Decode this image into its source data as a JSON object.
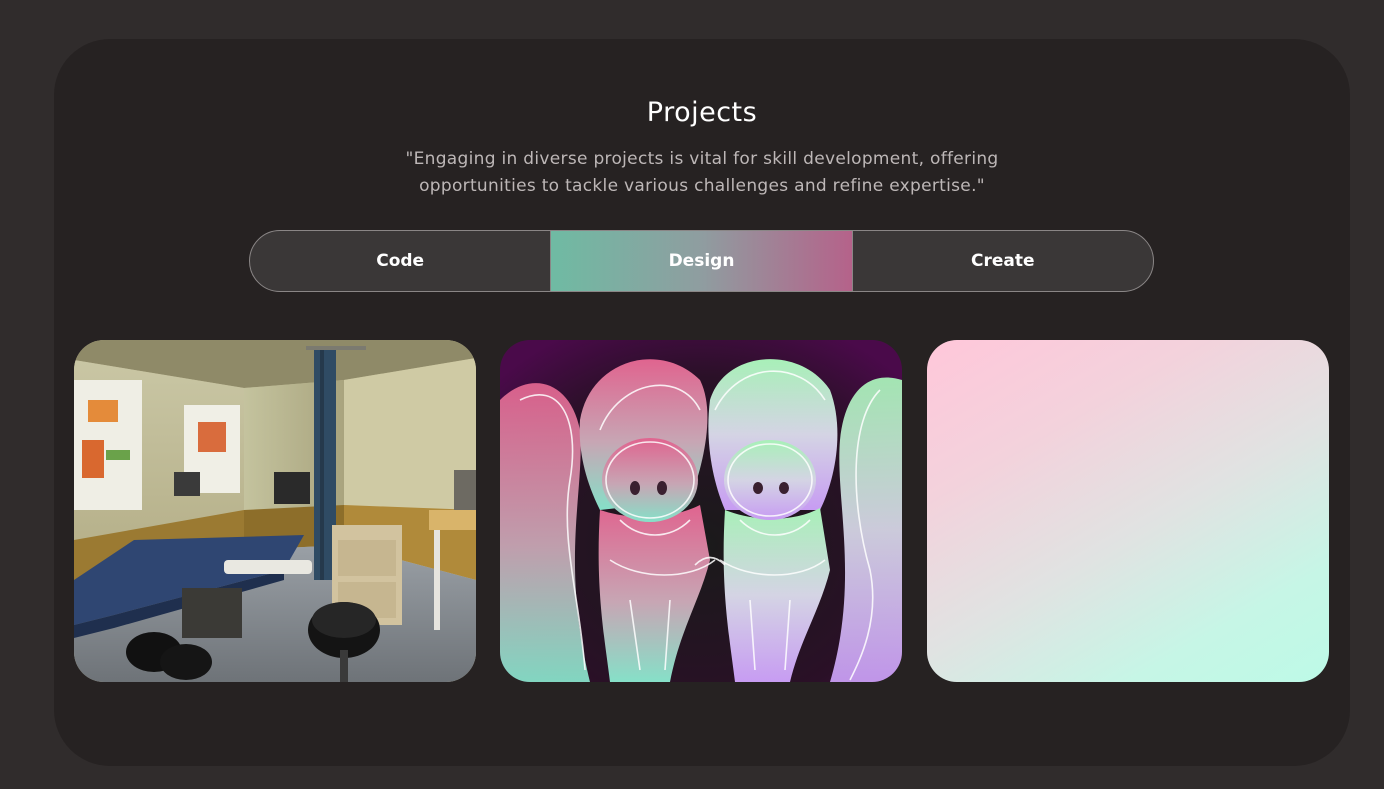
{
  "section": {
    "title": "Projects",
    "quote": "\"Engaging in diverse projects is vital for skill development, offering opportunities to tackle various challenges and refine expertise.\""
  },
  "tabs": [
    {
      "label": "Code",
      "active": false
    },
    {
      "label": "Design",
      "active": true
    },
    {
      "label": "Create",
      "active": false
    }
  ],
  "accent": {
    "tab_gradient": [
      "#6fbba3",
      "#b5628a"
    ],
    "background": "#302c2c",
    "panel": "#262222"
  },
  "cards": [
    {
      "image": "medical-exam-room-render"
    },
    {
      "image": "twin-characters-line-art"
    },
    {
      "image": "pink-mint-gradient-placeholder"
    }
  ]
}
